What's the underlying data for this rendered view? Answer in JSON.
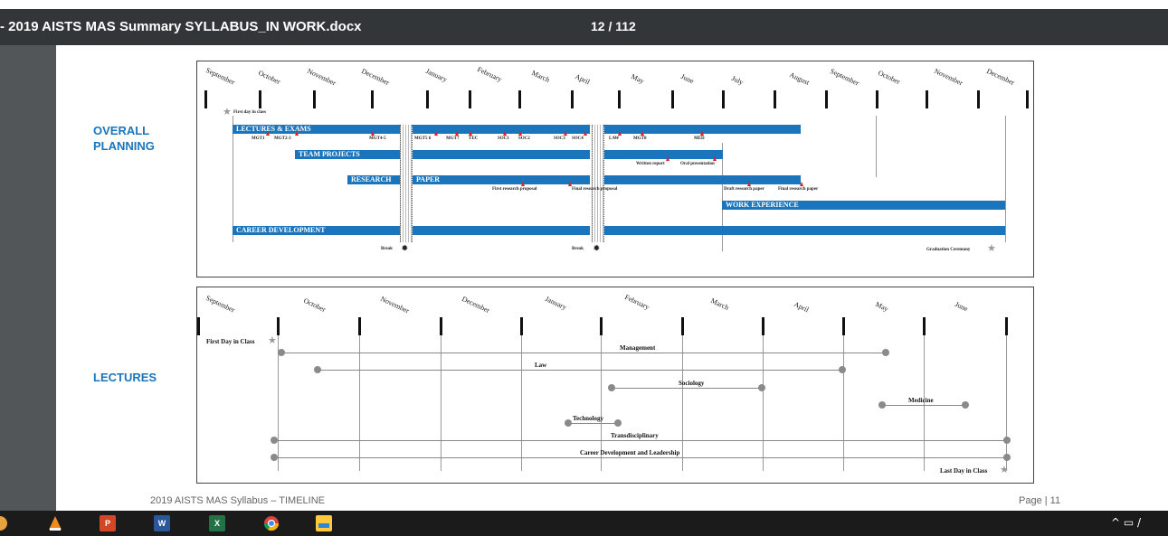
{
  "titlebar": {
    "doc_title": "- 2019 AISTS MAS Summary SYLLABUS_IN WORK.docx",
    "page_counter": "12 / 112"
  },
  "planning": {
    "section_label": "OVERALL\nPLANNING",
    "months": [
      "September",
      "October",
      "November",
      "December",
      "January",
      "February",
      "March",
      "April",
      "May",
      "June",
      "July",
      "August",
      "September",
      "October",
      "November",
      "December"
    ],
    "first_day": "First day in class",
    "bars": [
      {
        "label": "LECTURES & EXAMS"
      },
      {
        "label": "TEAM PROJECTS"
      },
      {
        "label": "RESEARCH"
      },
      {
        "label": "PAPER"
      },
      {
        "label": "WORK EXPERIENCE"
      },
      {
        "label": "CAREER DEVELOPMENT"
      }
    ],
    "exams": [
      "MGT1",
      "MGT2-3",
      "MGT4-5",
      "MGT5 6",
      "MGT7",
      "TEC",
      "SOC1",
      "SOC2",
      "SOC3",
      "SOC4",
      "LAW",
      "MGT8",
      "MED"
    ],
    "team_milestones": [
      "Written report",
      "Oral presentation"
    ],
    "paper_milestones": [
      "First research proposal",
      "Final research proposal",
      "Draft research paper",
      "Final research paper"
    ],
    "break_label": "Break",
    "graduation": "Graduation Ceremony"
  },
  "lectures": {
    "section_label": "LECTURES",
    "months": [
      "September",
      "October",
      "November",
      "December",
      "January",
      "February",
      "March",
      "April",
      "May",
      "June"
    ],
    "first_day": "First Day in Class",
    "last_day": "Last Day in Class",
    "courses": [
      "Management",
      "Law",
      "Sociology",
      "Medicine",
      "Technology",
      "Transdisciplinary",
      "Career Development and Leadership"
    ]
  },
  "footer": {
    "left": "2019 AISTS MAS Syllabus – TIMELINE",
    "right": "Page | 11"
  },
  "taskbar": {
    "apps": [
      "vlc-icon",
      "powerpoint-icon",
      "word-icon",
      "excel-icon",
      "chrome-icon",
      "file-explorer-icon"
    ],
    "tray": "^ ▭ /"
  },
  "colors": {
    "accent_blue": "#1b75bc",
    "milestone_red": "#e02020",
    "titlebar": "#323639",
    "viewer_bg": "#525659"
  }
}
